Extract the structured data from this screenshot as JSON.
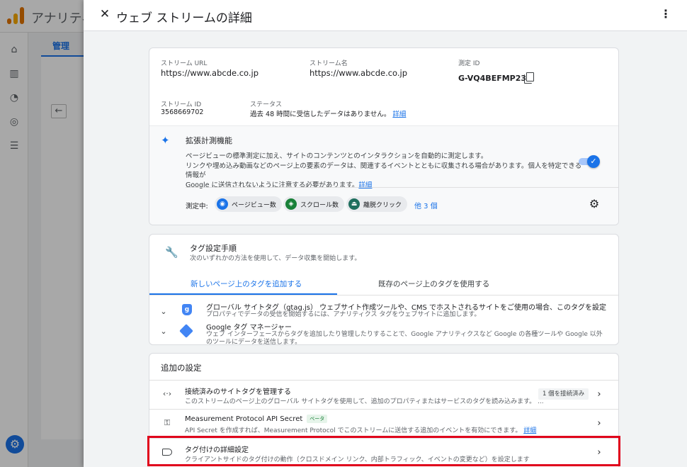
{
  "background_app": {
    "app_name": "アナリティ",
    "admin_tab": "管理"
  },
  "panel": {
    "title": "ウェブ ストリームの詳細",
    "close_icon": "close-icon",
    "menu_icon": "more-vert-icon"
  },
  "stream": {
    "url_label": "ストリーム URL",
    "url_value": "https://www.abcde.co.jp",
    "name_label": "ストリーム名",
    "name_value": "https://www.abcde.co.jp",
    "measurement_id_label": "測定 ID",
    "measurement_id_value": "G-VQ4BEFMP23",
    "stream_id_label": "ストリーム ID",
    "stream_id_value": "3568669702",
    "status_label": "ステータス",
    "status_value": "過去 48 時間に受信したデータはありません。",
    "status_link": "詳細"
  },
  "enhanced": {
    "title": "拡張計測機能",
    "desc_line1": "ページビューの標準測定に加え、サイトのコンテンツとのインタラクションを自動的に測定します。",
    "desc_line2": "リンクや埋め込み動画などのページ上の要素のデータは、関連するイベントとともに収集される場合があります。個人を特定できる情報が",
    "desc_line3": "Google に送信されないように注意する必要があります。",
    "desc_link": "詳細",
    "toggle_on": true,
    "measuring_label": "測定中:",
    "chips": [
      "ページビュー数",
      "スクロール数",
      "離脱クリック"
    ],
    "more_link": "他 3 個"
  },
  "tagging": {
    "title": "タグ設定手順",
    "subtitle": "次のいずれかの方法を使用して、データ収集を開始します。",
    "tab_active": "新しいページ上のタグを追加する",
    "tab_inactive": "既存のページ上のタグを使用する",
    "methods": [
      {
        "title": "グローバル サイトタグ（gtag.js） ウェブサイト作成ツールや、CMS でホストされるサイトをご使用の場合、このタグを設定",
        "desc": "プロパティでデータの受信を開始するには、アナリティクス タグをウェブサイトに追加します。"
      },
      {
        "title": "Google タグ マネージャー",
        "desc": "ウェブ インターフェースからタグを追加したり管理したりすることで、Google アナリティクスなど Google の各種ツールや Google 以外のツールにデータを送信します。"
      }
    ]
  },
  "additional": {
    "title": "追加の設定",
    "rows": [
      {
        "title": "接続済みのサイトタグを管理する",
        "desc": "このストリームのページ上のグローバル サイトタグを使用して、追加のプロパティまたはサービスのタグを読み込みます。 ...",
        "badge": "1 個を接続済み"
      },
      {
        "title": "Measurement Protocol API Secret",
        "beta": "ベータ",
        "desc": "API Secret を作成すれば、Measurement Protocol でこのストリームに送信する追加のイベントを有効にできます。",
        "link": "詳細"
      },
      {
        "title": "タグ付けの詳細設定",
        "desc": "クライアントサイドのタグ付けの動作（クロスドメイン リンク、内部トラフィック、イベントの変更など）を設定します"
      }
    ]
  },
  "colors": {
    "accent": "#1a73e8",
    "highlight": "#e0001b"
  }
}
